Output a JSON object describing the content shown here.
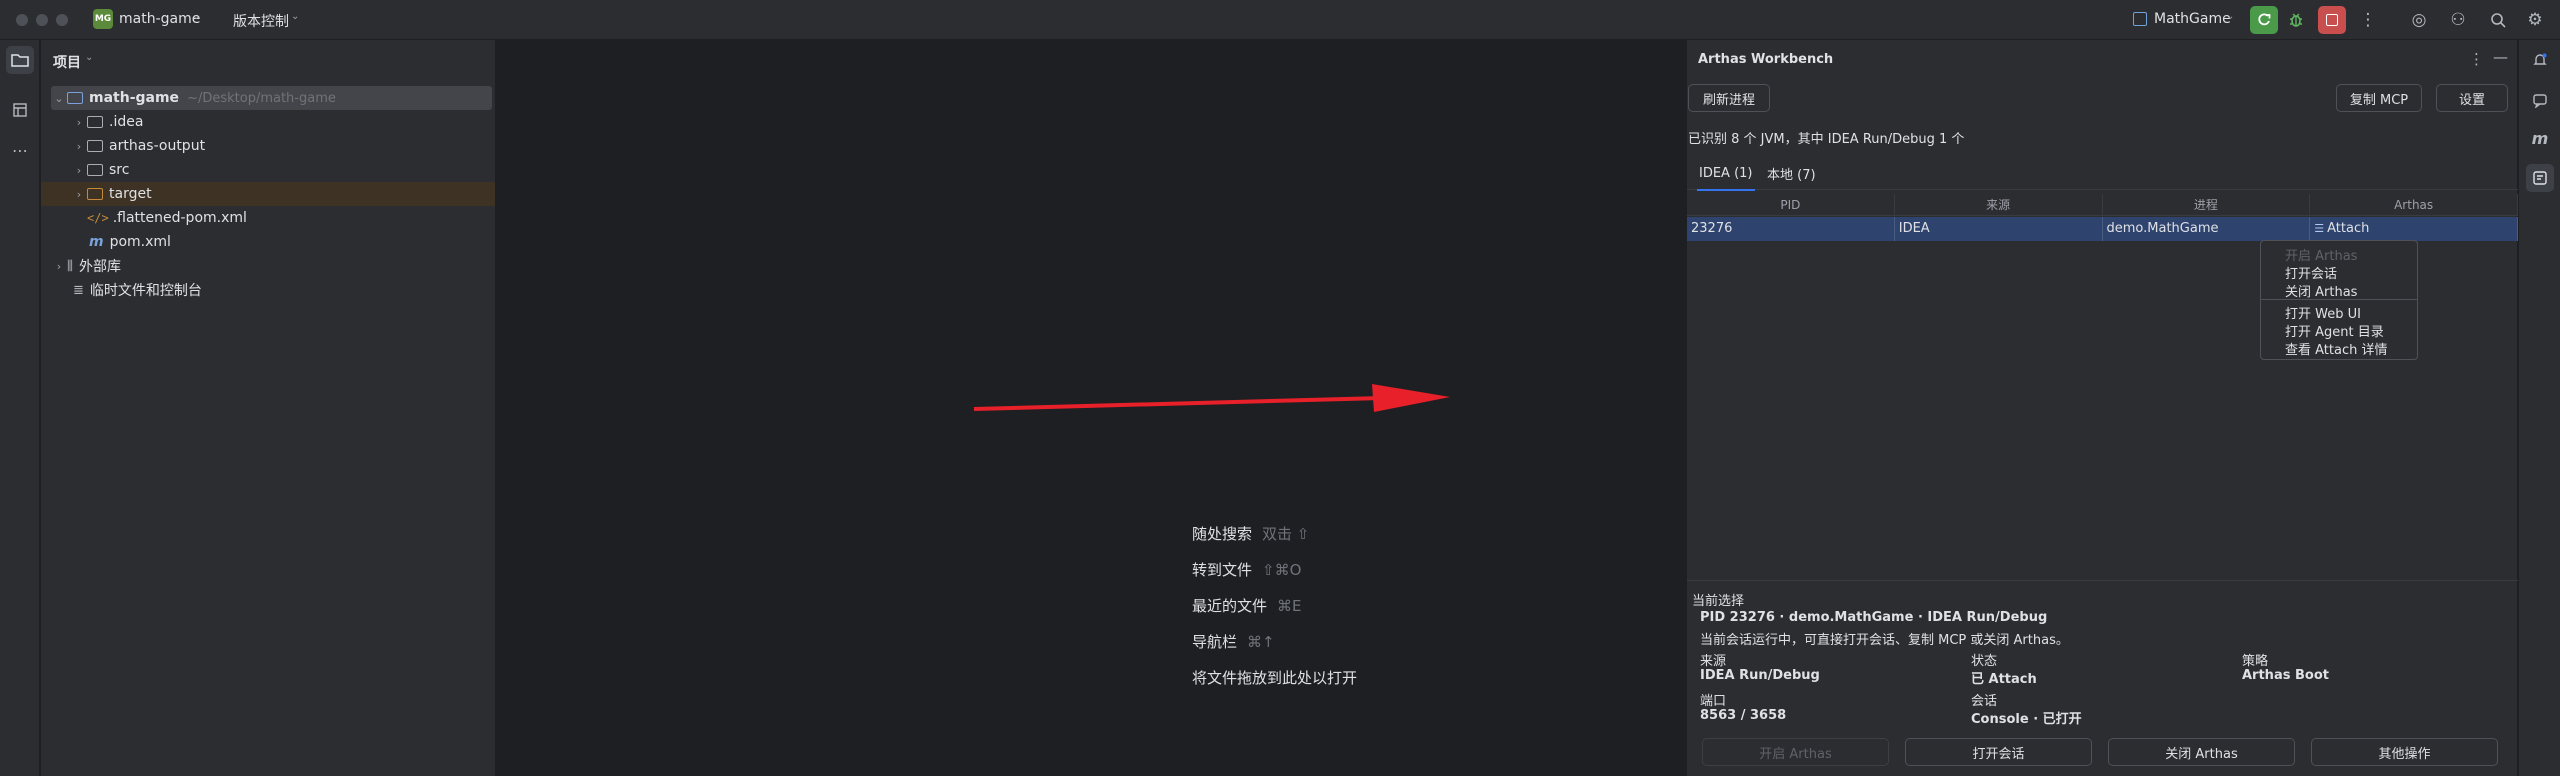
{
  "titlebar": {
    "project_badge": "MG",
    "project_name": "math-game",
    "vcs_label": "版本控制",
    "run_config": "MathGame"
  },
  "project_panel": {
    "title": "项目",
    "root_name": "math-game",
    "root_path": "~/Desktop/math-game",
    "items": [
      {
        "label": ".idea"
      },
      {
        "label": "arthas-output"
      },
      {
        "label": "src"
      },
      {
        "label": "target"
      },
      {
        "label": ".flattened-pom.xml"
      },
      {
        "label": "pom.xml"
      }
    ],
    "external_libs": "外部库",
    "scratches": "临时文件和控制台"
  },
  "editor_hints": [
    {
      "label": "随处搜索",
      "shortcut": "双击 ⇧"
    },
    {
      "label": "转到文件",
      "shortcut": "⇧⌘O"
    },
    {
      "label": "最近的文件",
      "shortcut": "⌘E"
    },
    {
      "label": "导航栏",
      "shortcut": "⌘↑"
    },
    {
      "label": "将文件拖放到此处以打开",
      "shortcut": ""
    }
  ],
  "arthas": {
    "title": "Arthas Workbench",
    "refresh_button": "刷新进程",
    "copy_mcp_button": "复制 MCP",
    "settings_button": "设置",
    "summary": "已识别 8 个 JVM，其中 IDEA Run/Debug 1 个",
    "tabs": [
      {
        "label": "IDEA (1)"
      },
      {
        "label": "本地 (7)"
      }
    ],
    "columns": [
      "PID",
      "来源",
      "进程",
      "Arthas"
    ],
    "rows": [
      {
        "pid": "23276",
        "source": "IDEA",
        "process": "demo.MathGame",
        "arthas": "Attach"
      }
    ],
    "context_menu": [
      {
        "label": "开启 Arthas",
        "enabled": false
      },
      {
        "label": "打开会话",
        "enabled": true
      },
      {
        "label": "关闭 Arthas",
        "enabled": true
      },
      {
        "label": "打开 Web UI",
        "enabled": true
      },
      {
        "label": "打开 Agent 目录",
        "enabled": true
      },
      {
        "label": "查看 Attach 详情",
        "enabled": true
      }
    ],
    "selection": {
      "section_title": "当前选择",
      "headline": "PID 23276 · demo.MathGame · IDEA Run/Debug",
      "description": "当前会话运行中，可直接打开会话、复制 MCP 或关闭 Arthas。",
      "source_label": "来源",
      "source_value": "IDEA Run/Debug",
      "status_label": "状态",
      "status_value": "已 Attach",
      "strategy_label": "策略",
      "strategy_value": "Arthas Boot",
      "port_label": "端口",
      "port_value": "8563 / 3658",
      "session_label": "会话",
      "session_value": "Console · 已打开"
    },
    "bottom_buttons": [
      {
        "label": "开启 Arthas",
        "enabled": false
      },
      {
        "label": "打开会话",
        "enabled": true
      },
      {
        "label": "关闭 Arthas",
        "enabled": true
      },
      {
        "label": "其他操作",
        "enabled": true
      }
    ]
  },
  "colors": {
    "accent": "#3574f0",
    "selection_row": "#2e436e",
    "run_button": "#4a9a4a",
    "stop_button": "#c94f4f",
    "arrow": "#e8202a"
  }
}
